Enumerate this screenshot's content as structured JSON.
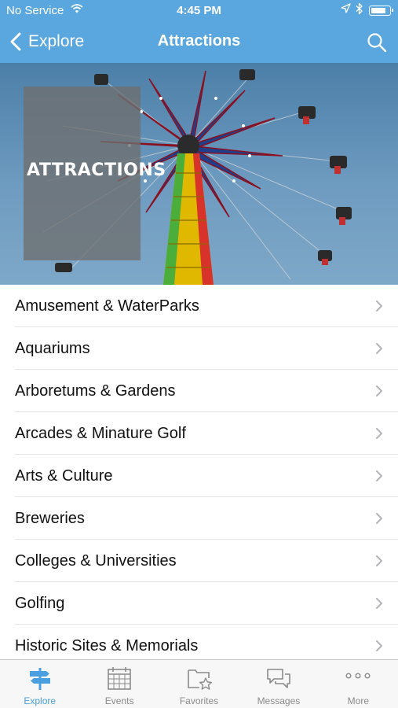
{
  "status_bar": {
    "carrier": "No Service",
    "time": "4:45 PM"
  },
  "nav": {
    "back_label": "Explore",
    "title": "Attractions"
  },
  "hero": {
    "label": "ATTRACTIONS"
  },
  "categories": [
    {
      "label": "Amusement & WaterParks"
    },
    {
      "label": "Aquariums"
    },
    {
      "label": "Arboretums & Gardens"
    },
    {
      "label": "Arcades & Minature Golf"
    },
    {
      "label": "Arts & Culture"
    },
    {
      "label": "Breweries"
    },
    {
      "label": "Colleges & Universities"
    },
    {
      "label": "Golfing"
    },
    {
      "label": "Historic Sites & Memorials"
    }
  ],
  "tabs": [
    {
      "label": "Explore",
      "icon": "signpost-icon",
      "active": true
    },
    {
      "label": "Events",
      "icon": "calendar-icon",
      "active": false
    },
    {
      "label": "Favorites",
      "icon": "folder-star-icon",
      "active": false
    },
    {
      "label": "Messages",
      "icon": "chat-bubbles-icon",
      "active": false
    },
    {
      "label": "More",
      "icon": "ellipsis-icon",
      "active": false
    }
  ],
  "colors": {
    "header_blue": "#5aa7e0",
    "active_tab": "#4a9fe0",
    "inactive_tab": "#8a8a8a"
  }
}
